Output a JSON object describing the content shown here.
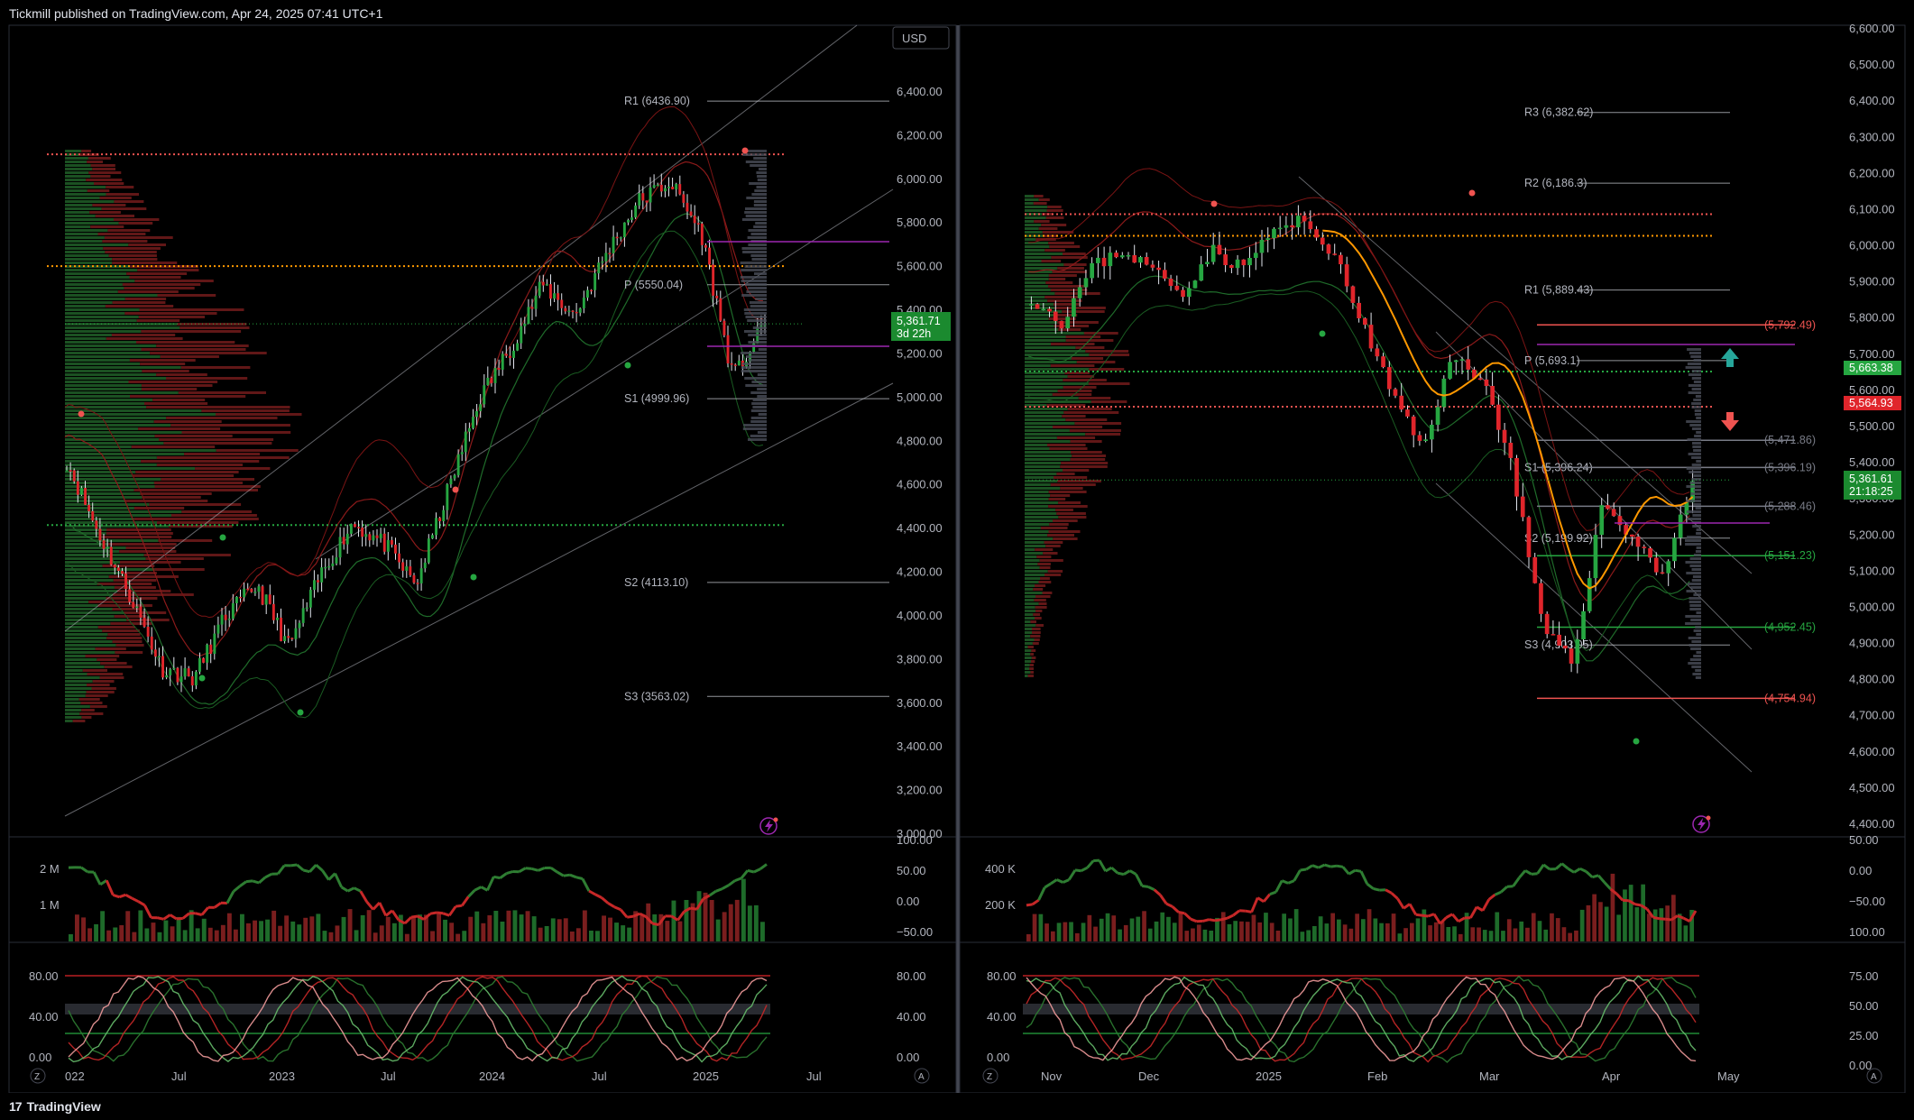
{
  "header": {
    "attribution": "Tickmill published on TradingView.com, Apr 24, 2025 07:41 UTC+1"
  },
  "footer": {
    "brand": "TradingView",
    "brand_mark": "17"
  },
  "colors": {
    "up": "#26a641",
    "down": "#e0252b",
    "orange": "#ff9800",
    "purple": "#9c27b0",
    "bg": "#000000"
  },
  "left": {
    "currency_button": "USD",
    "price_axis": [
      "6,400.00",
      "6,200.00",
      "6,000.00",
      "5,800.00",
      "5,600.00",
      "5,400.00",
      "5,200.00",
      "5,000.00",
      "4,800.00",
      "4,600.00",
      "4,400.00",
      "4,200.00",
      "4,000.00",
      "3,800.00",
      "3,600.00",
      "3,400.00",
      "3,200.00",
      "3,000.00"
    ],
    "price_badge": {
      "value": "5,361.71",
      "countdown": "3d 22h"
    },
    "levels": [
      {
        "label": "R1 (6436.90)",
        "value": 6436.9
      },
      {
        "label": "P (5550.04)",
        "value": 5550.04
      },
      {
        "label": "S1 (4999.96)",
        "value": 4999.96
      },
      {
        "label": "S2 (4113.10)",
        "value": 4113.1
      },
      {
        "label": "S3 (3563.02)",
        "value": 3563.02
      }
    ],
    "time_axis": [
      "022",
      "Jul",
      "2023",
      "Jul",
      "2024",
      "Jul",
      "2025",
      "Jul"
    ],
    "volume_axis": [
      "2 M",
      "1 M"
    ],
    "osc1_axis": [
      "100.00",
      "50.00",
      "0.00",
      "−50.00"
    ],
    "osc2_axis_left": [
      "80.00",
      "40.00",
      "0.00"
    ],
    "osc2_axis_right": [
      "80.00",
      "40.00",
      "0.00"
    ],
    "scale_mode_left": "Z",
    "scale_mode_right": "A"
  },
  "right": {
    "price_axis": [
      "6,600.00",
      "6,500.00",
      "6,400.00",
      "6,300.00",
      "6,200.00",
      "6,100.00",
      "6,000.00",
      "5,900.00",
      "5,800.00",
      "5,700.00",
      "5,600.00",
      "5,500.00",
      "5,400.00",
      "5,300.00",
      "5,200.00",
      "5,100.00",
      "5,000.00",
      "4,900.00",
      "4,800.00",
      "4,700.00",
      "4,600.00",
      "4,500.00",
      "4,400.00"
    ],
    "price_badge": {
      "value": "5,361.61",
      "countdown": "21:18:25"
    },
    "badge_green": "5,663.38",
    "badge_red": "5,564.93",
    "levels": [
      {
        "label": "R3 (6,382.62)",
        "value": 6382.62
      },
      {
        "label": "R2 (6,186.3)",
        "value": 6186.3
      },
      {
        "label": "R1 (5,889.43)",
        "value": 5889.43
      },
      {
        "label": "P (5,693.1)",
        "value": 5693.1
      },
      {
        "label": "S1 (5,396.24)",
        "value": 5396.24
      },
      {
        "label": "S2 (5,199.92)",
        "value": 5199.92
      },
      {
        "label": "S3 (4,903.05)",
        "value": 4903.05
      }
    ],
    "zone_levels": [
      {
        "label": "(5,792.49)",
        "value": 5792.49,
        "color": "#ef5350"
      },
      {
        "label": "(5,471.86)",
        "value": 5471.86,
        "color": "#787b86"
      },
      {
        "label": "(5,396.19)",
        "value": 5396.19,
        "color": "#787b86"
      },
      {
        "label": "(5,288.46)",
        "value": 5288.46,
        "color": "#787b86"
      },
      {
        "label": "(5,151.23)",
        "value": 5151.23,
        "color": "#26a641"
      },
      {
        "label": "(4,952.45)",
        "value": 4952.45,
        "color": "#26a641"
      },
      {
        "label": "(4,754.94)",
        "value": 4754.94,
        "color": "#ef5350"
      }
    ],
    "time_axis": [
      "Nov",
      "Dec",
      "2025",
      "Feb",
      "Mar",
      "Apr",
      "May"
    ],
    "volume_axis": [
      "400 K",
      "200 K"
    ],
    "osc1_axis": [
      "50.00",
      "0.00",
      "−50.00",
      "100.00"
    ],
    "osc2_axis_left": [
      "80.00",
      "40.00",
      "0.00"
    ],
    "osc2_axis_right": [
      "75.00",
      "50.00",
      "25.00",
      "0.00"
    ],
    "scale_mode_left": "Z",
    "scale_mode_right": "A"
  }
}
